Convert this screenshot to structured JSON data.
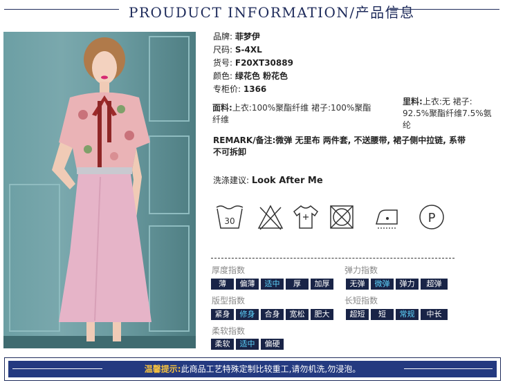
{
  "header": {
    "title": "PROUDUCT INFORMATION/产品信息"
  },
  "product": {
    "brand_label": "品牌:",
    "brand": "菲梦伊",
    "size_label": "尺码:",
    "size": "S-4XL",
    "sku_label": "货号:",
    "sku": "F20XT30889",
    "color_label": "颜色:",
    "color": "绿花色 粉花色",
    "price_label": "专柜价:",
    "price": "1366",
    "fabric_label": "面料:",
    "fabric_line1": "上衣:100%聚酯纤维    裙子:100%聚酯",
    "fabric_line2": "纤维",
    "lining_label": "里料:",
    "lining_line1": "上衣:无 裙子:",
    "lining_line2": "92.5%聚酯纤维7.5%氨",
    "lining_line3": "纶",
    "remark_label": "REMARK/备注:",
    "remark_line1": "微弹 无里布 两件套, 不送腰带, 裙子侧中拉链, 系带",
    "remark_line2": "不可拆卸",
    "wash_label": "洗涤建议:",
    "wash": "Look After Me"
  },
  "care_icons": [
    {
      "name": "wash-30-icon",
      "text": "30"
    },
    {
      "name": "no-bleach-icon"
    },
    {
      "name": "hang-dry-icon"
    },
    {
      "name": "no-tumble-dry-icon"
    },
    {
      "name": "low-iron-icon"
    },
    {
      "name": "dry-clean-p-icon",
      "text": "P"
    }
  ],
  "indices": {
    "thickness": {
      "label": "厚度指数",
      "options": [
        "薄",
        "偏薄",
        "适中",
        "厚",
        "加厚"
      ],
      "selected": "适中"
    },
    "elasticity": {
      "label": "弹力指数",
      "options": [
        "无弹",
        "微弹",
        "弹力",
        "超弹"
      ],
      "selected": "微弹"
    },
    "fit": {
      "label": "版型指数",
      "options": [
        "紧身",
        "修身",
        "合身",
        "宽松",
        "肥大"
      ],
      "selected": "修身"
    },
    "length": {
      "label": "长短指数",
      "options": [
        "超短",
        "短",
        "常规",
        "中长"
      ],
      "selected": "常规"
    },
    "softness": {
      "label": "柔软指数",
      "options": [
        "柔软",
        "适中",
        "偏硬"
      ],
      "selected": "适中"
    }
  },
  "notice": {
    "warn": "温馨提示:",
    "text": "此商品工艺特殊定制比较重工,请勿机洗,勿浸泡。"
  },
  "colors": {
    "navy": "#192447",
    "highlight": "#5fd6ff",
    "warning": "#f3c040",
    "skirt_pink": "#e6b4c8"
  }
}
